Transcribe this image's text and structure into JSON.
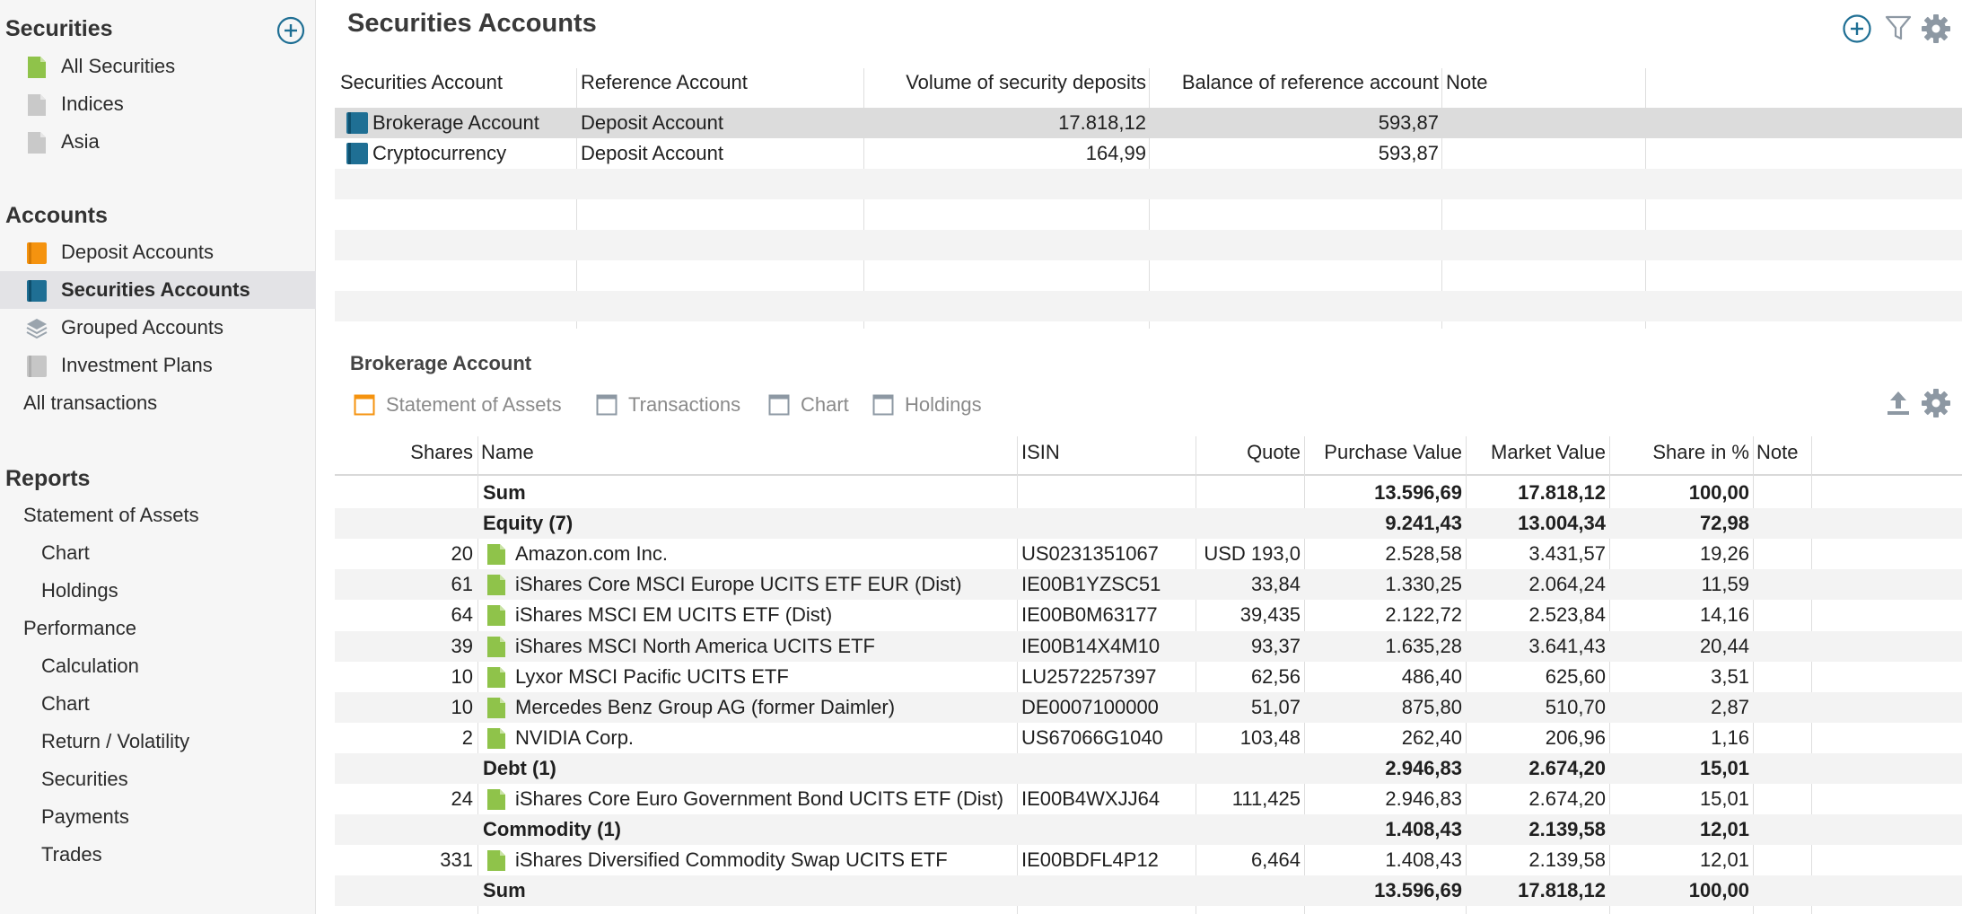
{
  "sidebar": {
    "sections": {
      "securities": "Securities",
      "accounts": "Accounts",
      "reports": "Reports"
    },
    "securities_items": [
      {
        "label": "All Securities",
        "icon": "doc-green-icon"
      },
      {
        "label": "Indices",
        "icon": "doc-gray-icon"
      },
      {
        "label": "Asia",
        "icon": "doc-gray-icon"
      }
    ],
    "accounts_items": [
      {
        "label": "Deposit Accounts",
        "icon": "book-orange-icon"
      },
      {
        "label": "Securities Accounts",
        "icon": "book-teal-icon"
      },
      {
        "label": "Grouped Accounts",
        "icon": "layers-icon"
      },
      {
        "label": "Investment Plans",
        "icon": "book-gray-icon"
      },
      {
        "label": "All transactions"
      }
    ],
    "reports_items": [
      {
        "label": "Statement of Assets"
      },
      {
        "label": "Chart"
      },
      {
        "label": "Holdings"
      },
      {
        "label": "Performance"
      },
      {
        "label": "Calculation"
      },
      {
        "label": "Chart"
      },
      {
        "label": "Return / Volatility"
      },
      {
        "label": "Securities"
      },
      {
        "label": "Payments"
      },
      {
        "label": "Trades"
      }
    ],
    "selected": "Securities Accounts"
  },
  "main": {
    "title": "Securities Accounts",
    "top_table": {
      "headers": [
        "Securities Account",
        "Reference Account",
        "Volume of security deposits",
        "Balance of reference account",
        "Note"
      ],
      "rows": [
        [
          "Brokerage Account",
          "Deposit Account",
          "17.818,12",
          "593,87",
          ""
        ],
        [
          "Cryptocurrency",
          "Deposit Account",
          "164,99",
          "593,87",
          ""
        ]
      ]
    },
    "detail": {
      "title": "Brokerage Account",
      "tabs": [
        "Statement of Assets",
        "Transactions",
        "Chart",
        "Holdings"
      ],
      "active_tab": "Statement of Assets",
      "headers": [
        "Shares",
        "Name",
        "ISIN",
        "Quote",
        "Purchase Value",
        "Market Value",
        "Share in %",
        "Note"
      ],
      "rows": [
        {
          "type": "sum",
          "cells": [
            "",
            "Sum",
            "",
            "",
            "13.596,69",
            "17.818,12",
            "100,00",
            ""
          ]
        },
        {
          "type": "group",
          "cells": [
            "",
            "Equity (7)",
            "",
            "",
            "9.241,43",
            "13.004,34",
            "72,98",
            ""
          ]
        },
        {
          "type": "item",
          "cells": [
            "20",
            "Amazon.com Inc.",
            "US0231351067",
            "USD 193,0",
            "2.528,58",
            "3.431,57",
            "19,26",
            ""
          ]
        },
        {
          "type": "item",
          "cells": [
            "61",
            "iShares Core MSCI Europe UCITS ETF EUR (Dist)",
            "IE00B1YZSC51",
            "33,84",
            "1.330,25",
            "2.064,24",
            "11,59",
            ""
          ]
        },
        {
          "type": "item",
          "cells": [
            "64",
            "iShares MSCI EM UCITS ETF (Dist)",
            "IE00B0M63177",
            "39,435",
            "2.122,72",
            "2.523,84",
            "14,16",
            ""
          ]
        },
        {
          "type": "item",
          "cells": [
            "39",
            "iShares MSCI North America UCITS ETF",
            "IE00B14X4M10",
            "93,37",
            "1.635,28",
            "3.641,43",
            "20,44",
            ""
          ]
        },
        {
          "type": "item",
          "cells": [
            "10",
            "Lyxor MSCI Pacific UCITS ETF",
            "LU2572257397",
            "62,56",
            "486,40",
            "625,60",
            "3,51",
            ""
          ]
        },
        {
          "type": "item",
          "cells": [
            "10",
            "Mercedes Benz Group AG (former Daimler)",
            "DE0007100000",
            "51,07",
            "875,80",
            "510,70",
            "2,87",
            ""
          ]
        },
        {
          "type": "item",
          "cells": [
            "2",
            "NVIDIA Corp.",
            "US67066G1040",
            "103,48",
            "262,40",
            "206,96",
            "1,16",
            ""
          ]
        },
        {
          "type": "group",
          "cells": [
            "",
            "Debt (1)",
            "",
            "",
            "2.946,83",
            "2.674,20",
            "15,01",
            ""
          ]
        },
        {
          "type": "item",
          "cells": [
            "24",
            "iShares Core Euro Government Bond UCITS ETF (Dist)",
            "IE00B4WXJJ64",
            "111,425",
            "2.946,83",
            "2.674,20",
            "15,01",
            ""
          ]
        },
        {
          "type": "group",
          "cells": [
            "",
            "Commodity (1)",
            "",
            "",
            "1.408,43",
            "2.139,58",
            "12,01",
            ""
          ]
        },
        {
          "type": "item",
          "cells": [
            "331",
            "iShares Diversified Commodity Swap UCITS ETF",
            "IE00BDFL4P12",
            "6,464",
            "1.408,43",
            "2.139,58",
            "12,01",
            ""
          ]
        },
        {
          "type": "sum",
          "cells": [
            "",
            "Sum",
            "",
            "",
            "13.596,69",
            "17.818,12",
            "100,00",
            ""
          ]
        }
      ]
    }
  },
  "colors": {
    "accent_teal": "#1f6f94",
    "accent_orange": "#f5930f",
    "doc_green": "#8fc34a",
    "icon_gray": "#8d98a3"
  }
}
